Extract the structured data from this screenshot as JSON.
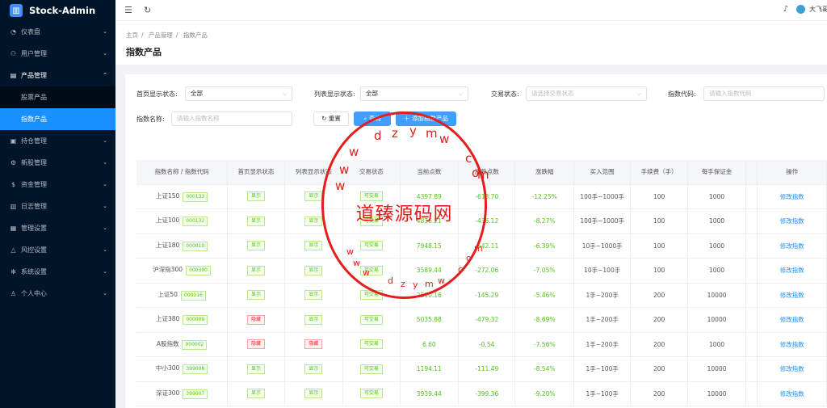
{
  "app": {
    "name": "Stock-Admin"
  },
  "sidebar": {
    "items": [
      {
        "label": "仪表盘",
        "icon": "dashboard-icon",
        "glyph": "◔"
      },
      {
        "label": "用户管理",
        "icon": "user-group-icon",
        "glyph": "⚇"
      },
      {
        "label": "产品管理",
        "icon": "product-icon",
        "glyph": "▤",
        "expanded": true,
        "children": [
          {
            "label": "股票产品"
          },
          {
            "label": "指数产品",
            "active": true
          }
        ]
      },
      {
        "label": "持仓管理",
        "icon": "position-icon",
        "glyph": "▣"
      },
      {
        "label": "新股管理",
        "icon": "new-stock-icon",
        "glyph": "⚙"
      },
      {
        "label": "资金管理",
        "icon": "money-icon",
        "glyph": "$"
      },
      {
        "label": "日志管理",
        "icon": "log-icon",
        "glyph": "▥"
      },
      {
        "label": "管理设置",
        "icon": "admin-icon",
        "glyph": "▦"
      },
      {
        "label": "风控设置",
        "icon": "risk-icon",
        "glyph": "△"
      },
      {
        "label": "系统设置",
        "icon": "system-settings-icon",
        "glyph": "✻"
      },
      {
        "label": "个人中心",
        "icon": "personal-icon",
        "glyph": "♙"
      }
    ]
  },
  "topbar": {
    "user": "大飞哥"
  },
  "breadcrumb": [
    "主页",
    "产品管理",
    "指数产品"
  ],
  "page_title": "指数产品",
  "filters": {
    "home_status": {
      "label": "首页显示状态:",
      "value": "全部"
    },
    "list_status": {
      "label": "列表显示状态:",
      "value": "全部"
    },
    "trade_status": {
      "label": "交易状态:",
      "placeholder": "请选择交易状态"
    },
    "index_code": {
      "label": "指数代码:",
      "placeholder": "请输入指数代码"
    },
    "index_name": {
      "label": "指数名称:",
      "placeholder": "请输入指数名称"
    },
    "reset": "重置",
    "search": "查询",
    "add": "添加指数产品"
  },
  "table": {
    "headers": [
      "指数名称 / 指数代码",
      "首页显示状态",
      "列表显示状态",
      "交易状态",
      "当前点数",
      "涨跌点数",
      "涨跌幅",
      "买入范围",
      "手续费（手）",
      "每手保证金",
      "",
      "操作"
    ],
    "rows": [
      {
        "name": "上证150",
        "code": "000133",
        "home": "显示",
        "list": "显示",
        "trade": "可交易",
        "price": "4397.89",
        "chg": "-613.70",
        "pct": "-12.25%",
        "range": "100手~1000手",
        "fee": "100",
        "margin": "1000",
        "action": "修改指数"
      },
      {
        "name": "上证100",
        "code": "000132",
        "home": "显示",
        "list": "显示",
        "trade": "可交易",
        "price": "4836.21",
        "chg": "-436.12",
        "pct": "-8.27%",
        "range": "100手~1000手",
        "fee": "100",
        "margin": "1000",
        "action": "修改指数"
      },
      {
        "name": "上证180",
        "code": "000010",
        "home": "显示",
        "list": "显示",
        "trade": "可交易",
        "price": "7948.15",
        "chg": "-542.11",
        "pct": "-6.39%",
        "range": "10手~1000手",
        "fee": "100",
        "margin": "1000",
        "action": "修改指数"
      },
      {
        "name": "沪深指300",
        "code": "000300",
        "home": "显示",
        "list": "显示",
        "trade": "可交易",
        "price": "3589.44",
        "chg": "-272.06",
        "pct": "-7.05%",
        "range": "10手~100手",
        "fee": "100",
        "margin": "1000",
        "action": "修改指数"
      },
      {
        "name": "上证50",
        "code": "000016",
        "home": "显示",
        "list": "显示",
        "trade": "可交易",
        "price": "2510.16",
        "chg": "-145.29",
        "pct": "-5.46%",
        "range": "1手~200手",
        "fee": "200",
        "margin": "10000",
        "action": "修改指数"
      },
      {
        "name": "上证380",
        "code": "000009",
        "home": "隐藏",
        "list": "显示",
        "trade": "可交易",
        "price": "5035.88",
        "chg": "-479.32",
        "pct": "-8.69%",
        "range": "1手~200手",
        "fee": "200",
        "margin": "10000",
        "action": "修改指数"
      },
      {
        "name": "A股指数",
        "code": "000002",
        "home": "隐藏",
        "list": "隐藏",
        "trade": "可交易",
        "price": "6.60",
        "chg": "-0.54",
        "pct": "-7.56%",
        "range": "1手~200手",
        "fee": "200",
        "margin": "1000",
        "action": "修改指数"
      },
      {
        "name": "中小300",
        "code": "399008",
        "home": "显示",
        "list": "显示",
        "trade": "可交易",
        "price": "1194.11",
        "chg": "-111.49",
        "pct": "-8.54%",
        "range": "1手~100手",
        "fee": "200",
        "margin": "10000",
        "action": "修改指数"
      },
      {
        "name": "深证300",
        "code": "399007",
        "home": "显示",
        "list": "显示",
        "trade": "可交易",
        "price": "3939.44",
        "chg": "-399.36",
        "pct": "-9.20%",
        "range": "1手~100手",
        "fee": "200",
        "margin": "10000",
        "action": "修改指数"
      }
    ]
  },
  "watermark": {
    "text": "道臻源码网",
    "url": "www.dzym.com",
    "url_lower": "www.dzym.com"
  },
  "colors": {
    "sidebar_bg": "#001529",
    "accent": "#1890ff",
    "stamp": "#e41d1d"
  }
}
